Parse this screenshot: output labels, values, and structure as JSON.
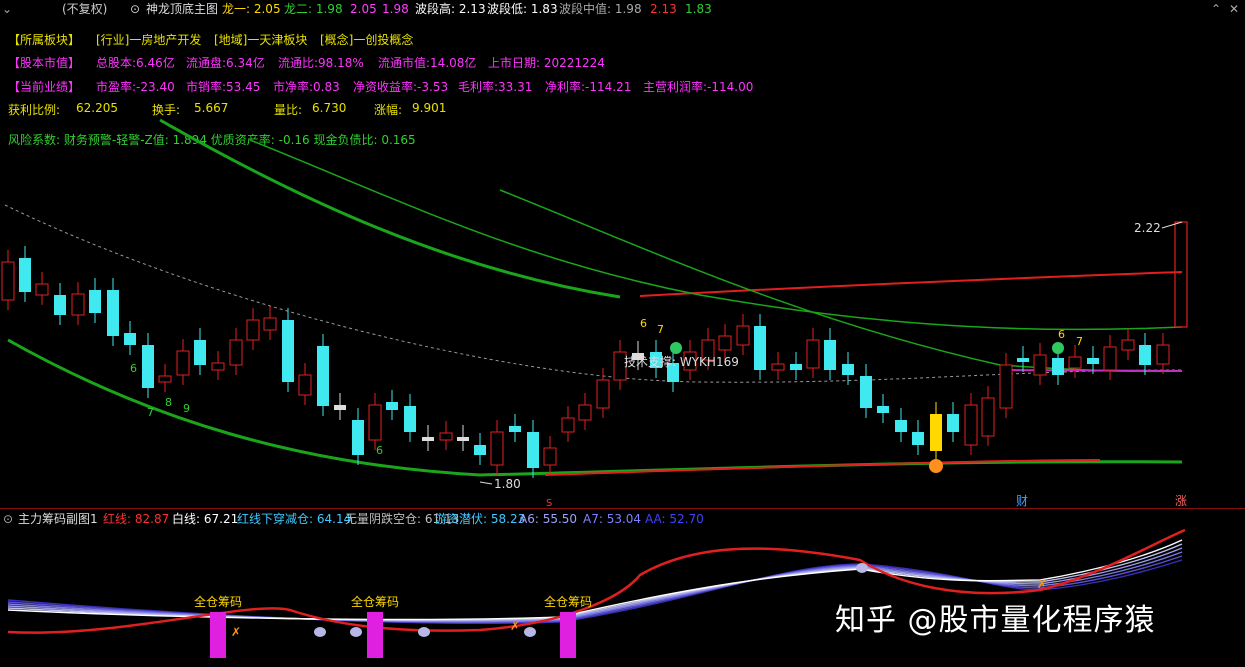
{
  "title_bar": {
    "prefix": "(不复权)",
    "indicator_name": "神龙顶底主图",
    "items": [
      {
        "label": "龙一:",
        "value": "2.05",
        "color": "#ffd700"
      },
      {
        "label": "龙二:",
        "value": "1.98",
        "color": "#30d030"
      },
      {
        "label": "",
        "value": "2.05",
        "color": "#ff40ff"
      },
      {
        "label": "",
        "value": "1.98",
        "color": "#ff40ff"
      },
      {
        "label": "波段高:",
        "value": "2.13",
        "color": "#ffffff"
      },
      {
        "label": "波段低:",
        "value": "1.83",
        "color": "#ffffff"
      },
      {
        "label": "波段中值:",
        "value": "1.98",
        "color": "#aaaaaa"
      },
      {
        "label": "",
        "value": "2.13",
        "color": "#ff3030"
      },
      {
        "label": "",
        "value": "1.83",
        "color": "#30d030"
      }
    ]
  },
  "info": {
    "row1": {
      "block": "【所属板块】",
      "industry": "[行业]一房地产开发",
      "region": "[地域]一天津板块",
      "concept": "[概念]一创投概念"
    },
    "row2": {
      "label": "【股本市值】",
      "total_shares": "总股本:6.46亿",
      "float_shares": "流通盘:6.34亿",
      "float_ratio": "流通比:98.18%",
      "float_mktcap": "流通市值:14.08亿",
      "list_date": "上市日期: 20221224"
    },
    "row3": {
      "label": "【当前业绩】",
      "pe": "市盈率:-23.40",
      "ps": "市销率:53.45",
      "pb": "市净率:0.83",
      "roe": "净资收益率:-3.53",
      "gross": "毛利率:33.31",
      "net": "净利率:-114.21",
      "main": "主营利润率:-114.00"
    },
    "row4": {
      "profit_ratio_label": "获利比例:",
      "profit_ratio": "62.205",
      "turnover_label": "换手:",
      "turnover": "5.667",
      "volume_ratio_label": "量比:",
      "volume_ratio": "6.730",
      "change_label": "涨幅:",
      "change": "9.901"
    },
    "row5": "风险系数: 财务预警-轻警-Z值: 1.894 优质资产率: -0.16 现金负债比: 0.165"
  },
  "chart": {
    "high_label": "2.22",
    "low_label": "1.80",
    "annotation": "技术支撑: WYKH169",
    "counts": [
      "6",
      "7",
      "8",
      "9",
      "6",
      "6",
      "7",
      "6",
      "7"
    ],
    "bottom_tags": [
      "财",
      "涨"
    ],
    "marker_s": "S"
  },
  "sub_chart": {
    "name": "主力筹码副图1",
    "items": [
      {
        "label": "红线:",
        "value": "82.87",
        "color": "#ff3030"
      },
      {
        "label": "白线:",
        "value": "67.21",
        "color": "#ffffff"
      },
      {
        "label": "红线下穿减仓:",
        "value": "64.14",
        "color": "#40c8ff"
      },
      {
        "label": "无量阴跌空仓:",
        "value": "61.13",
        "color": "#c0c0c0"
      },
      {
        "label": "游资潜伏:",
        "value": "58.23",
        "color": "#40c8ff"
      },
      {
        "label": "A6:",
        "value": "55.50",
        "color": "#a0a0ff"
      },
      {
        "label": "A7:",
        "value": "53.04",
        "color": "#8080ff"
      },
      {
        "label": "AA:",
        "value": "52.70",
        "color": "#4040ff"
      }
    ],
    "signal_label": "全仓筹码"
  },
  "watermark": "知乎 @股市量化程序猿"
}
